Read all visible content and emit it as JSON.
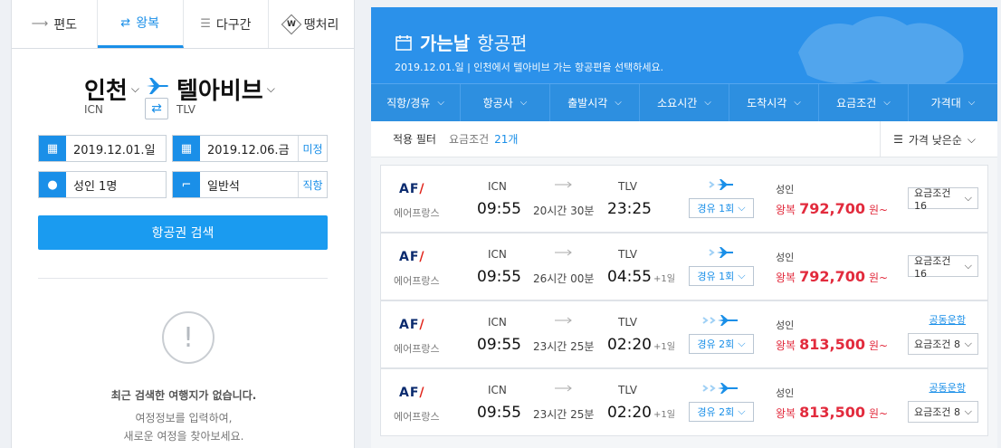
{
  "tabs": [
    {
      "label": "편도",
      "icon": "one-way-arrow-icon"
    },
    {
      "label": "왕복",
      "icon": "round-trip-arrows-icon",
      "active": true
    },
    {
      "label": "다구간",
      "icon": "multi-city-icon"
    },
    {
      "label": "땡처리",
      "icon": "w-badge-icon"
    }
  ],
  "route": {
    "from_city": "인천",
    "from_code": "ICN",
    "to_city": "텔아비브",
    "to_code": "TLV"
  },
  "form": {
    "depart_date": "2019.12.01.일",
    "return_date": "2019.12.06.금",
    "return_tag": "미정",
    "passengers": "성인 1명",
    "seat_class": "일반석",
    "direct_tag": "직항"
  },
  "search_button": "항공권 검색",
  "empty": {
    "title": "최근 검색한 여행지가 없습니다.",
    "desc_line1": "여정정보를 입력하여,",
    "desc_line2": "새로운 여정을 찾아보세요."
  },
  "header": {
    "title_bold": "가는날",
    "title_light": "항공편",
    "subtitle": "2019.12.01.일  |  인천에서 텔아비브 가는 항공편을 선택하세요."
  },
  "filters": [
    "직항/경유",
    "항공사",
    "출발시각",
    "소요시간",
    "도착시각",
    "요금조건",
    "가격대"
  ],
  "applied": {
    "label": "적용 필터",
    "cond": "요금조건",
    "count": "21개"
  },
  "sort": {
    "label": "가격 낮은순"
  },
  "flights": [
    {
      "airline_logo": "AF",
      "airline_name": "에어프랑스",
      "dep_code": "ICN",
      "dep_time": "09:55",
      "duration": "20시간 30분",
      "arr_code": "TLV",
      "arr_time": "23:25",
      "arr_plus": "",
      "stops": "경유 1회",
      "pax": "성인",
      "price_type": "왕복",
      "price": "792,700",
      "won": "원~",
      "codeshare": "",
      "fare": "요금조건 16"
    },
    {
      "airline_logo": "AF",
      "airline_name": "에어프랑스",
      "dep_code": "ICN",
      "dep_time": "09:55",
      "duration": "26시간 00분",
      "arr_code": "TLV",
      "arr_time": "04:55",
      "arr_plus": "+1일",
      "stops": "경유 1회",
      "pax": "성인",
      "price_type": "왕복",
      "price": "792,700",
      "won": "원~",
      "codeshare": "",
      "fare": "요금조건 16"
    },
    {
      "airline_logo": "AF",
      "airline_name": "에어프랑스",
      "dep_code": "ICN",
      "dep_time": "09:55",
      "duration": "23시간 25분",
      "arr_code": "TLV",
      "arr_time": "02:20",
      "arr_plus": "+1일",
      "stops": "경유 2회",
      "pax": "성인",
      "price_type": "왕복",
      "price": "813,500",
      "won": "원~",
      "codeshare": "공동운항",
      "fare": "요금조건 8"
    },
    {
      "airline_logo": "AF",
      "airline_name": "에어프랑스",
      "dep_code": "ICN",
      "dep_time": "09:55",
      "duration": "23시간 25분",
      "arr_code": "TLV",
      "arr_time": "02:20",
      "arr_plus": "+1일",
      "stops": "경유 2회",
      "pax": "성인",
      "price_type": "왕복",
      "price": "813,500",
      "won": "원~",
      "codeshare": "공동운항",
      "fare": "요금조건 8"
    }
  ],
  "colors": {
    "accent": "#1a8fe8",
    "header_bg": "#2b91ea",
    "price": "#e22b3d"
  }
}
